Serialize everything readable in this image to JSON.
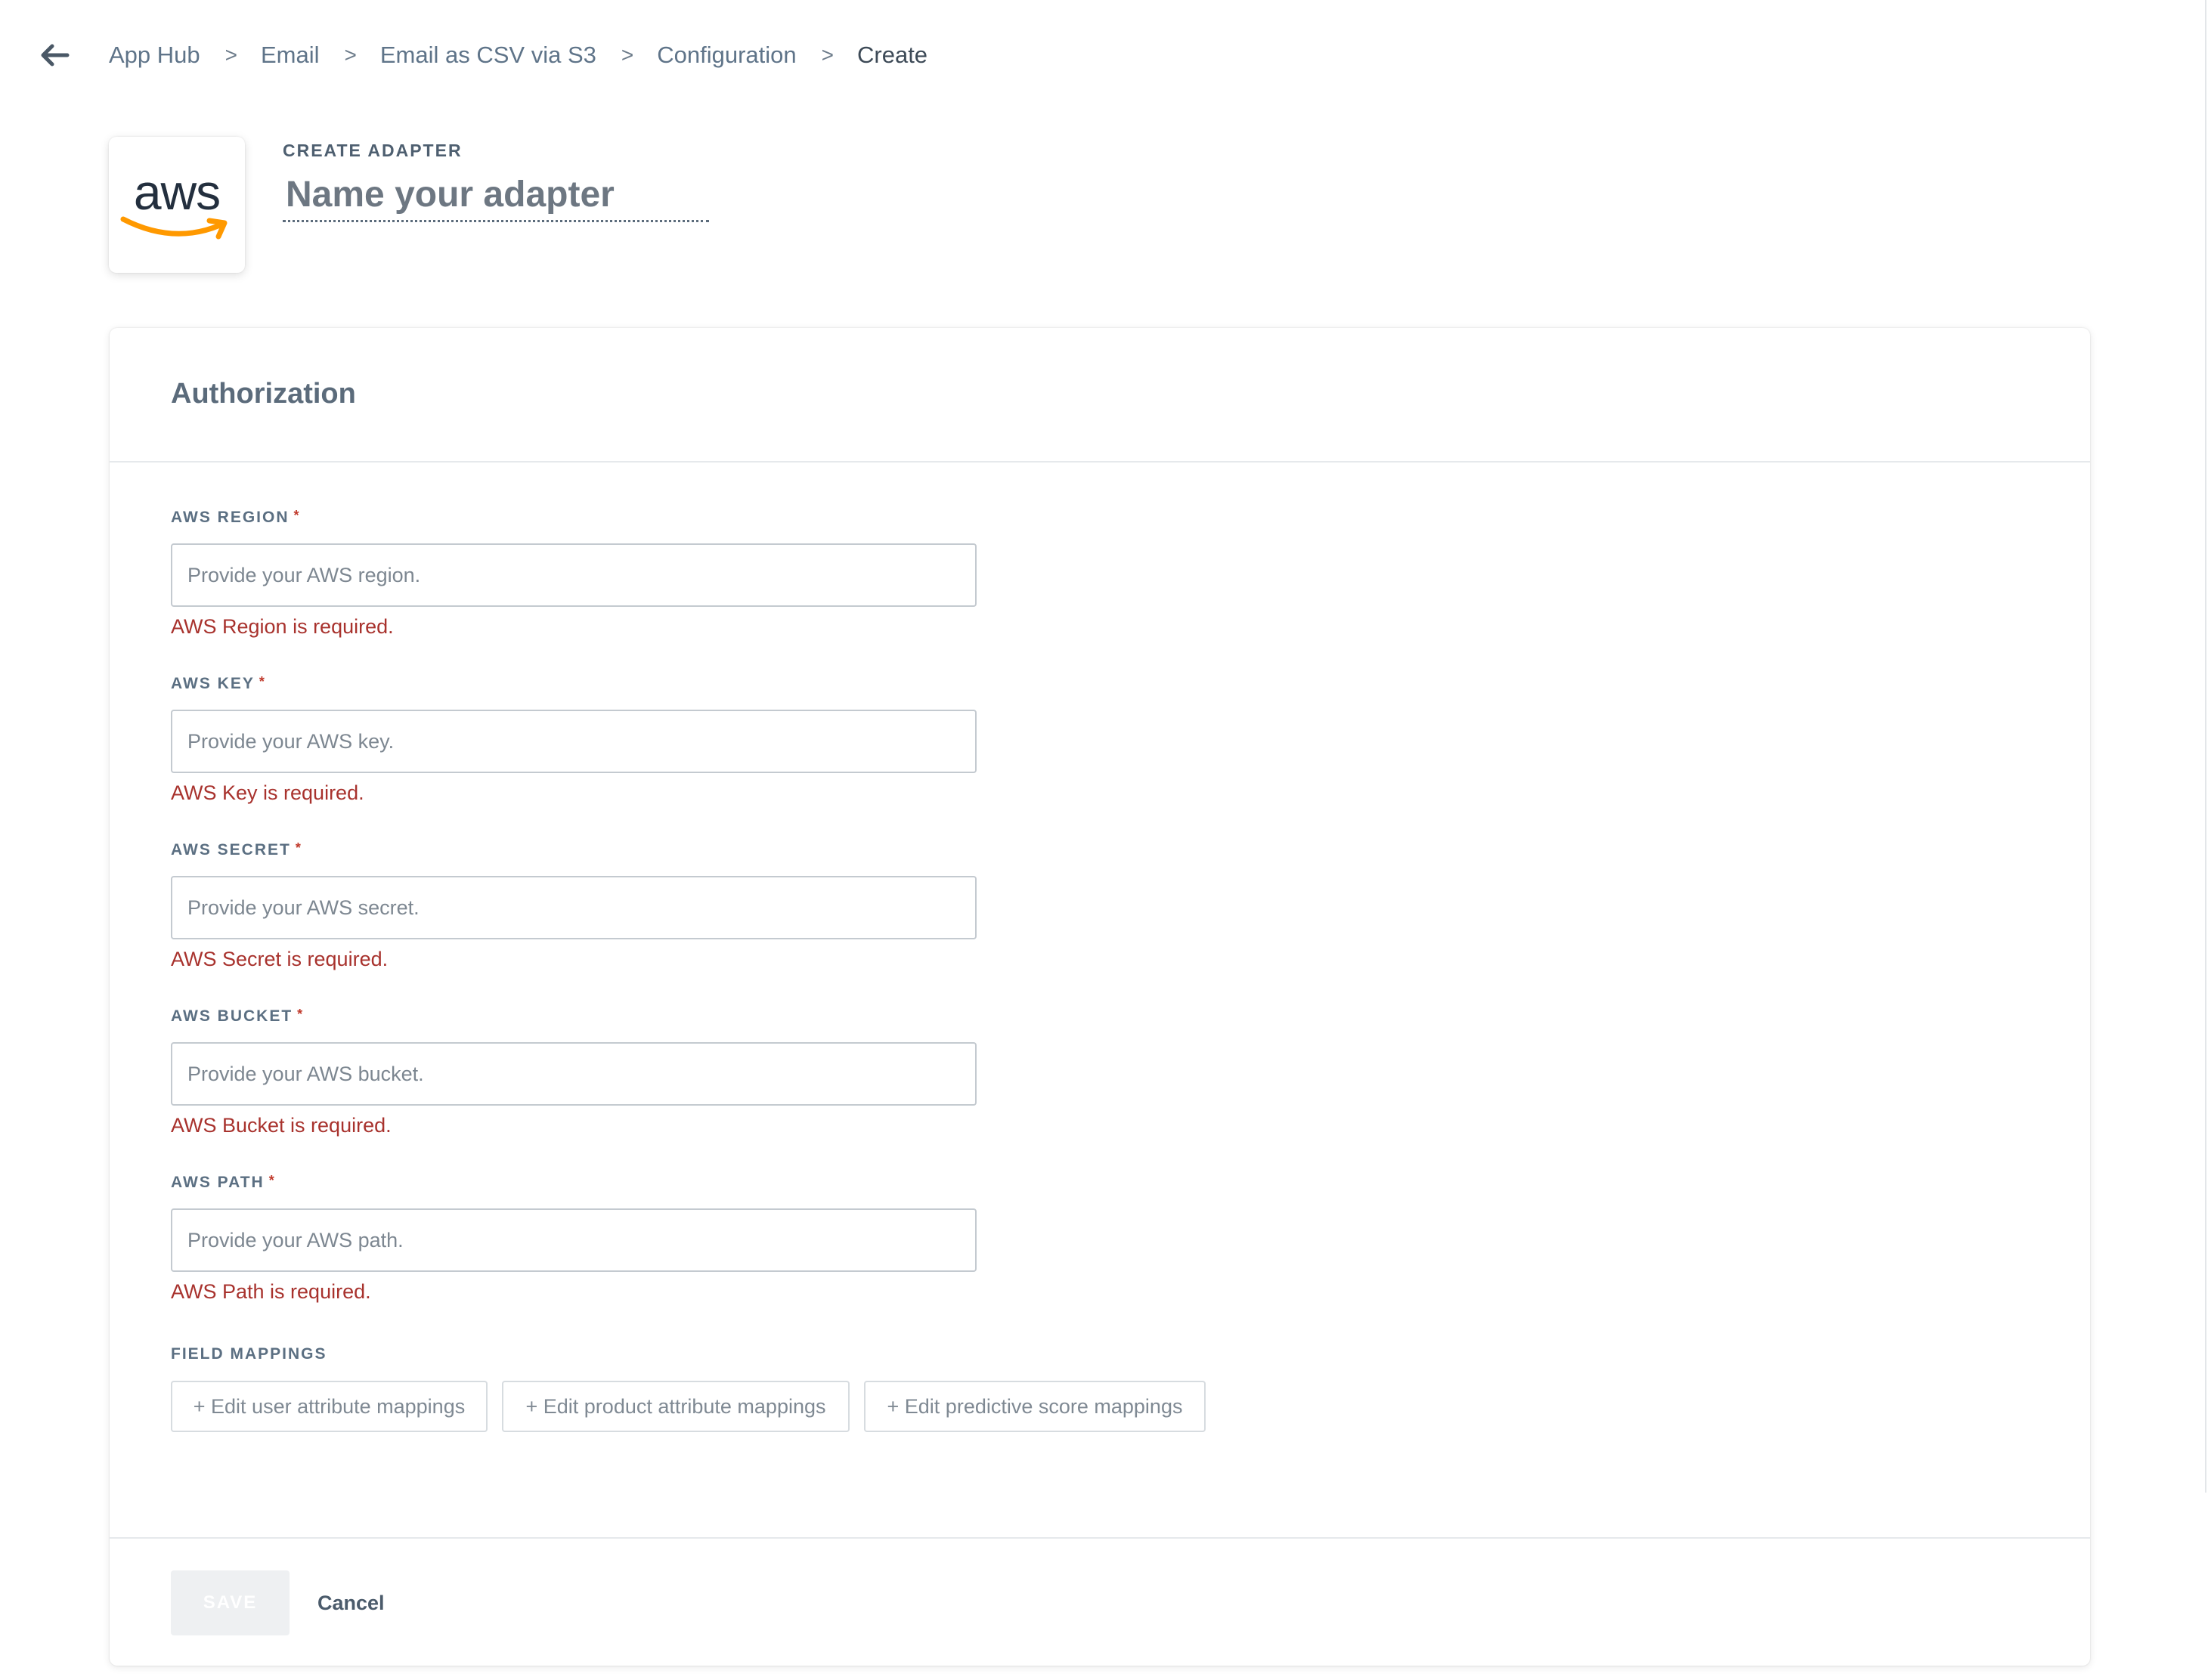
{
  "breadcrumb": {
    "items": [
      "App Hub",
      "Email",
      "Email as CSV via S3",
      "Configuration"
    ],
    "current": "Create",
    "separator": ">"
  },
  "header": {
    "logo_text": "aws",
    "overline": "CREATE ADAPTER",
    "name_placeholder": "Name your adapter",
    "name_value": ""
  },
  "authorization": {
    "title": "Authorization",
    "required_marker": "*",
    "fields": [
      {
        "label": "AWS REGION",
        "placeholder": "Provide your AWS region.",
        "value": "",
        "error": "AWS Region is required."
      },
      {
        "label": "AWS KEY",
        "placeholder": "Provide your AWS key.",
        "value": "",
        "error": "AWS Key is required."
      },
      {
        "label": "AWS SECRET",
        "placeholder": "Provide your AWS secret.",
        "value": "",
        "error": "AWS Secret is required."
      },
      {
        "label": "AWS BUCKET",
        "placeholder": "Provide your AWS bucket.",
        "value": "",
        "error": "AWS Bucket is required."
      },
      {
        "label": "AWS PATH",
        "placeholder": "Provide your AWS path.",
        "value": "",
        "error": "AWS Path is required."
      }
    ]
  },
  "field_mappings": {
    "label": "FIELD MAPPINGS",
    "buttons": [
      "+ Edit user attribute mappings",
      "+ Edit product attribute mappings",
      "+ Edit predictive score mappings"
    ]
  },
  "actions": {
    "save_label": "SAVE",
    "save_enabled": false,
    "cancel_label": "Cancel"
  },
  "colors": {
    "error": "#a8322d",
    "aws_smile": "#ff9900",
    "aws_text": "#232f3e"
  }
}
